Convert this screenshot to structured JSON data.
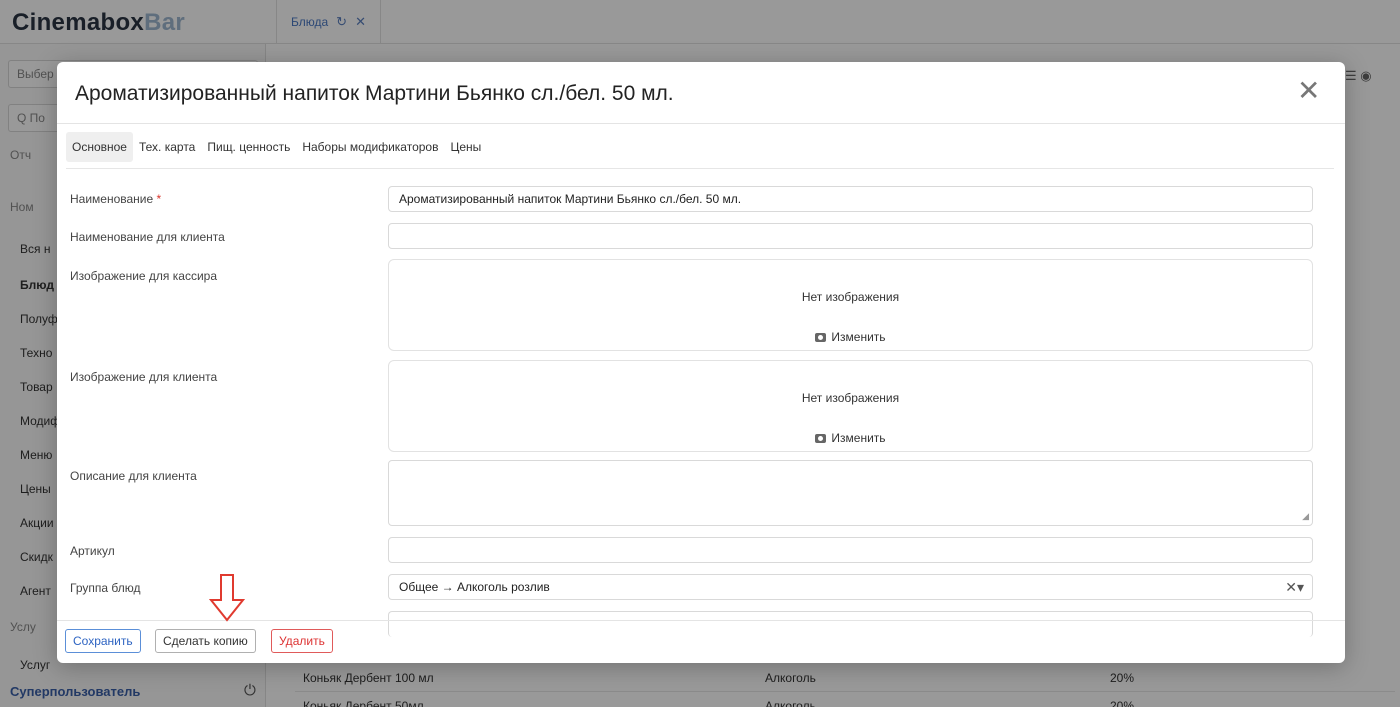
{
  "app": {
    "logo_main": "Cinemabox",
    "logo_accent": "Bar",
    "tab_label": "Блюда",
    "tab_refresh_icon": "refresh-icon",
    "tab_close_icon": "close-icon"
  },
  "sidebar": {
    "select_placeholder": "Выбер",
    "search_placeholder": "Q По",
    "items": [
      {
        "label": "Отч"
      },
      {
        "label": "Ном"
      },
      {
        "label": "Вся н"
      },
      {
        "label": "Блюд"
      },
      {
        "label": "Полуф"
      },
      {
        "label": "Техно"
      },
      {
        "label": "Товар"
      },
      {
        "label": "Модиф"
      },
      {
        "label": "Меню"
      },
      {
        "label": "Цены"
      },
      {
        "label": "Акции"
      },
      {
        "label": "Скидк"
      },
      {
        "label": "Агент"
      },
      {
        "label": "Услу"
      },
      {
        "label": "Услуг"
      }
    ],
    "user": "Суперпользователь"
  },
  "background_rows": [
    {
      "name": "Коньяк Дербент 100 мл",
      "group": "Алкоголь",
      "pct": "20%"
    },
    {
      "name": "Коньяк Дербент 50мл",
      "group": "Алкоголь",
      "pct": "20%"
    }
  ],
  "modal": {
    "title": "Ароматизированный напиток Мартини Бьянко сл./бел. 50 мл.",
    "close_icon": "close-icon",
    "tabs": [
      {
        "label": "Основное",
        "active": true
      },
      {
        "label": "Тех. карта"
      },
      {
        "label": "Пищ. ценность"
      },
      {
        "label": "Наборы модификаторов"
      },
      {
        "label": "Цены"
      }
    ],
    "fields": {
      "name_label": "Наименование",
      "name_required": "*",
      "name_value": "Ароматизированный напиток Мартини Бьянко сл./бел. 50 мл.",
      "client_name_label": "Наименование для клиента",
      "client_name_value": "",
      "cashier_image_label": "Изображение для кассира",
      "client_image_label": "Изображение для клиента",
      "no_image_text": "Нет изображения",
      "change_label": "Изменить",
      "description_label": "Описание для клиента",
      "description_value": "",
      "article_label": "Артикул",
      "article_value": "",
      "group_label": "Группа блюд",
      "group_value": "Общее → Алкоголь розлив"
    },
    "footer": {
      "save_label": "Сохранить",
      "copy_label": "Сделать копию",
      "delete_label": "Удалить"
    }
  },
  "colors": {
    "primary": "#2e64c2",
    "danger": "#d33",
    "arrow": "#e03a2f"
  }
}
